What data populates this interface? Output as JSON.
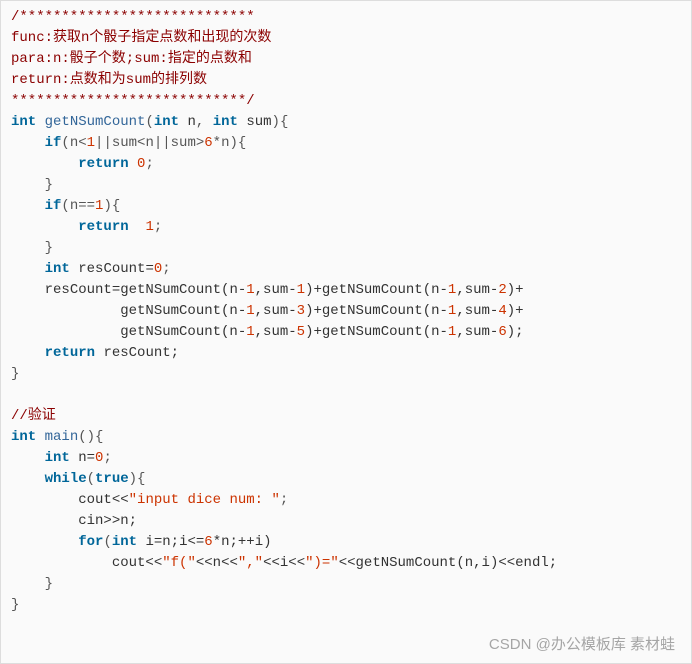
{
  "comment_block": {
    "line1": "/****************************",
    "line2": "func:获取n个骰子指定点数和出现的次数",
    "line3": "para:n:骰子个数;sum:指定的点数和",
    "line4": "return:点数和为sum的排列数",
    "line5": "****************************/"
  },
  "fn1": {
    "ret": "int",
    "name": "getNSumCount",
    "p1t": "int",
    "p1n": "n",
    "p2t": "int",
    "p2n": "sum",
    "open": "{",
    "if1": {
      "kw": "if",
      "cond_open": "(n<",
      "n1": "1",
      "or1": "||sum<n||sum>",
      "n6": "6",
      "rest": "*n){"
    },
    "ret0": {
      "kw": "return",
      "val": "0",
      "semi": ";"
    },
    "close1": "}",
    "if2": {
      "kw": "if",
      "cond": "(n==",
      "n1": "1",
      "close": "){"
    },
    "ret1": {
      "kw": "return",
      "val": "1",
      "semi": ";"
    },
    "close2": "}",
    "decl": {
      "ty": "int",
      "name": "resCount=",
      "val": "0",
      "semi": ";"
    },
    "assign": {
      "l1a": "resCount=getNSumCount(n-",
      "l1n1": "1",
      "l1b": ",sum-",
      "l1n2": "1",
      "l1c": ")+getNSumCount(n-",
      "l1n3": "1",
      "l1d": ",sum-",
      "l1n4": "2",
      "l1e": ")+",
      "l2a": "getNSumCount(n-",
      "l2n1": "1",
      "l2b": ",sum-",
      "l2n2": "3",
      "l2c": ")+getNSumCount(n-",
      "l2n3": "1",
      "l2d": ",sum-",
      "l2n4": "4",
      "l2e": ")+",
      "l3a": "getNSumCount(n-",
      "l3n1": "1",
      "l3b": ",sum-",
      "l3n2": "5",
      "l3c": ")+getNSumCount(n-",
      "l3n3": "1",
      "l3d": ",sum-",
      "l3n4": "6",
      "l3e": ");"
    },
    "retc": {
      "kw": "return",
      "name": "resCount;",
      "close": "}"
    }
  },
  "comment2": "//验证",
  "main": {
    "ret": "int",
    "name": "main",
    "parens": "(){",
    "decl": {
      "ty": "int",
      "name": "n=",
      "val": "0",
      "semi": ";"
    },
    "while": {
      "kw": "while",
      "open": "(",
      "true": "true",
      "close": "){"
    },
    "cout1": {
      "a": "cout<<",
      "str": "\"input dice num: \"",
      "semi": ";"
    },
    "cin": "cin>>n;",
    "for": {
      "kw": "for",
      "open": "(",
      "ty": "int",
      "body1": " i=n;i<=",
      "n6": "6",
      "body2": "*n;++i)"
    },
    "cout2": {
      "a": "cout<<",
      "s1": "\"f(\"",
      "b": "<<n<<",
      "s2": "\",\"",
      "c": "<<i<<",
      "s3": "\")=\"",
      "d": "<<getNSumCount(n,i)<<endl;"
    },
    "close1": "}",
    "close2": "}"
  },
  "watermark": "CSDN @办公模板库 素材蛙"
}
